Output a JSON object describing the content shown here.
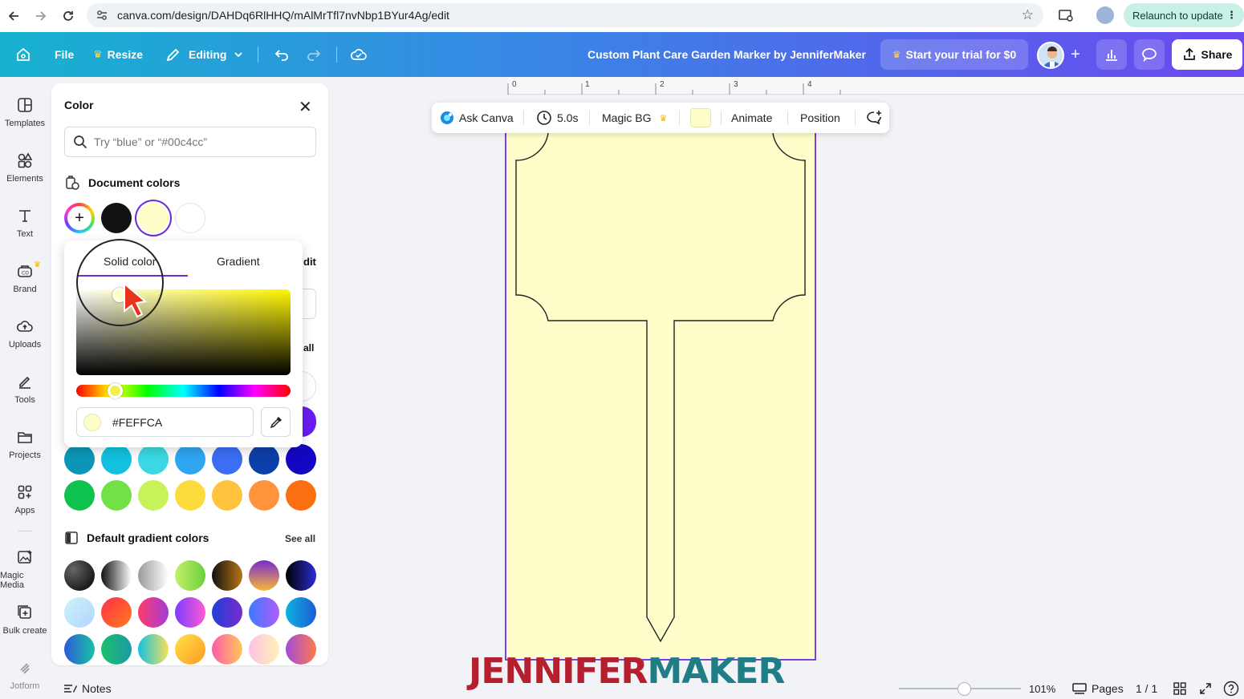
{
  "browser": {
    "url": "canva.com/design/DAHDq6RlHHQ/mAlMrTfl7nvNbp1BYur4Ag/edit",
    "relaunch_label": "Relaunch to update"
  },
  "topbar": {
    "file_label": "File",
    "resize_label": "Resize",
    "editing_label": "Editing",
    "doc_title": "Custom Plant Care Garden Marker by JenniferMaker",
    "trial_label": "Start your trial for $0",
    "share_label": "Share"
  },
  "rail": {
    "items": [
      {
        "label": "Templates",
        "icon": "templates-icon"
      },
      {
        "label": "Elements",
        "icon": "elements-icon"
      },
      {
        "label": "Text",
        "icon": "text-icon"
      },
      {
        "label": "Brand",
        "icon": "brand-icon"
      },
      {
        "label": "Uploads",
        "icon": "uploads-icon"
      },
      {
        "label": "Tools",
        "icon": "tools-icon"
      },
      {
        "label": "Projects",
        "icon": "projects-icon"
      },
      {
        "label": "Apps",
        "icon": "apps-icon"
      },
      {
        "label": "Magic Media",
        "icon": "magic-media-icon"
      },
      {
        "label": "Bulk create",
        "icon": "bulk-create-icon"
      },
      {
        "label": "Jotform",
        "icon": "jotform-icon"
      }
    ]
  },
  "panel": {
    "title": "Color",
    "search_placeholder": "Try “blue” or “#00c4cc”",
    "document_colors_label": "Document colors",
    "document_colors": [
      "#111111",
      "#fefeca",
      "#ffffff"
    ],
    "partial_edit": "dit",
    "partial_see_all": "all",
    "default_gradient_label": "Default gradient colors",
    "see_all_label": "See all",
    "solid_row_blue": [
      "#0b96b8",
      "#12c1e0",
      "#3ad8e4",
      "#2ea6f2",
      "#3b6ef5",
      "#0d3fa8",
      "#1407c4"
    ],
    "solid_row_warm": [
      "#0fc24e",
      "#72e047",
      "#c7f25a",
      "#fbdc3c",
      "#ffc33e",
      "#ff943a",
      "#fb6f13"
    ],
    "purple_partial": "#6a1cf0"
  },
  "picker": {
    "tab_solid": "Solid color",
    "tab_gradient": "Gradient",
    "hex_value": "#FEFFCA",
    "hue_position": 0.18
  },
  "canvas": {
    "ruler_marks": [
      "0",
      "1",
      "2",
      "3",
      "4"
    ],
    "page_color": "#fefeca"
  },
  "floatbar": {
    "ask_canva": "Ask Canva",
    "duration": "5.0s",
    "magic_bg": "Magic BG",
    "animate": "Animate",
    "position": "Position"
  },
  "watermark": {
    "part1": "JENNIFER",
    "part2": "MAKER"
  },
  "bottombar": {
    "notes_label": "Notes",
    "zoom_level": "101%",
    "pages_label": "Pages",
    "page_count": "1 / 1",
    "zoom_fraction": 0.53
  }
}
